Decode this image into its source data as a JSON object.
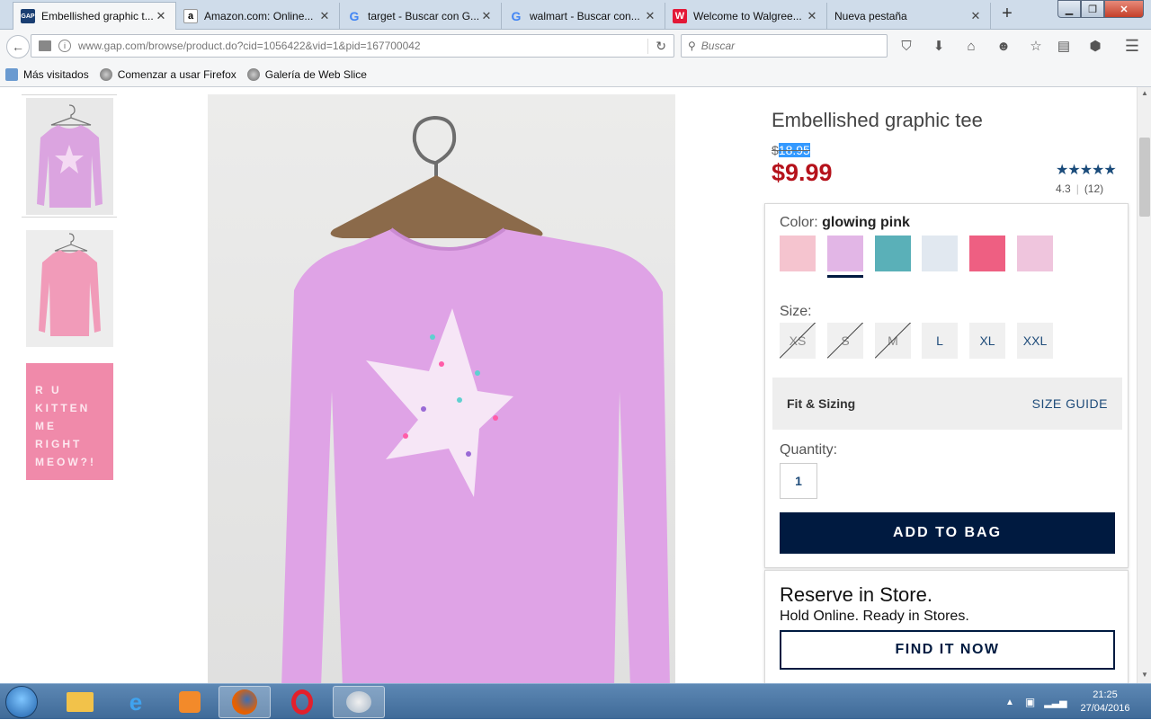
{
  "browser": {
    "tabs": [
      {
        "label": "Embellished graphic t...",
        "favicon": "gap-logo",
        "active": true
      },
      {
        "label": "Amazon.com: Online...",
        "favicon": "amazon-logo"
      },
      {
        "label": "target - Buscar con G...",
        "favicon": "google-logo"
      },
      {
        "label": "walmart - Buscar con...",
        "favicon": "google-logo"
      },
      {
        "label": "Welcome to Walgree...",
        "favicon": "walgreens-logo"
      },
      {
        "label": "Nueva pestaña",
        "favicon": ""
      }
    ],
    "url": "www.gap.com/browse/product.do?cid=1056422&vid=1&pid=167700042",
    "search_placeholder": "Buscar",
    "bookmarks": [
      "Más visitados",
      "Comenzar a usar Firefox",
      "Galería de Web Slice"
    ]
  },
  "product": {
    "title": "Embellished graphic tee",
    "original_price_symbol": "$",
    "original_price_value": "18.95",
    "sale_price": "$9.99",
    "stars": "★★★★★",
    "rating": "4.3",
    "review_count": "(12)",
    "color_label": "Color:",
    "color_value": "glowing pink",
    "swatch_colors": [
      "#f5c4cf",
      "#e2b6e6",
      "#5ab0b8",
      "#e1e8f0",
      "#ee5f82",
      "#efc5dd"
    ],
    "size_label": "Size:",
    "sizes": [
      {
        "label": "XS",
        "available": false
      },
      {
        "label": "S",
        "available": false
      },
      {
        "label": "M",
        "available": false
      },
      {
        "label": "L",
        "available": true
      },
      {
        "label": "XL",
        "available": true
      },
      {
        "label": "XXL",
        "available": true
      }
    ],
    "fit_label": "Fit & Sizing",
    "size_guide": "SIZE GUIDE",
    "quantity_label": "Quantity:",
    "quantity": "1",
    "add_to_bag": "ADD TO BAG",
    "thumb3_text": [
      "R U",
      "KITTEN",
      "ME",
      "RIGHT",
      "MEOW?!"
    ]
  },
  "store": {
    "title": "Reserve in Store.",
    "subtitle": "Hold Online. Ready in Stores.",
    "button": "FIND IT NOW"
  },
  "taskbar": {
    "time": "21:25",
    "date": "27/04/2016"
  }
}
